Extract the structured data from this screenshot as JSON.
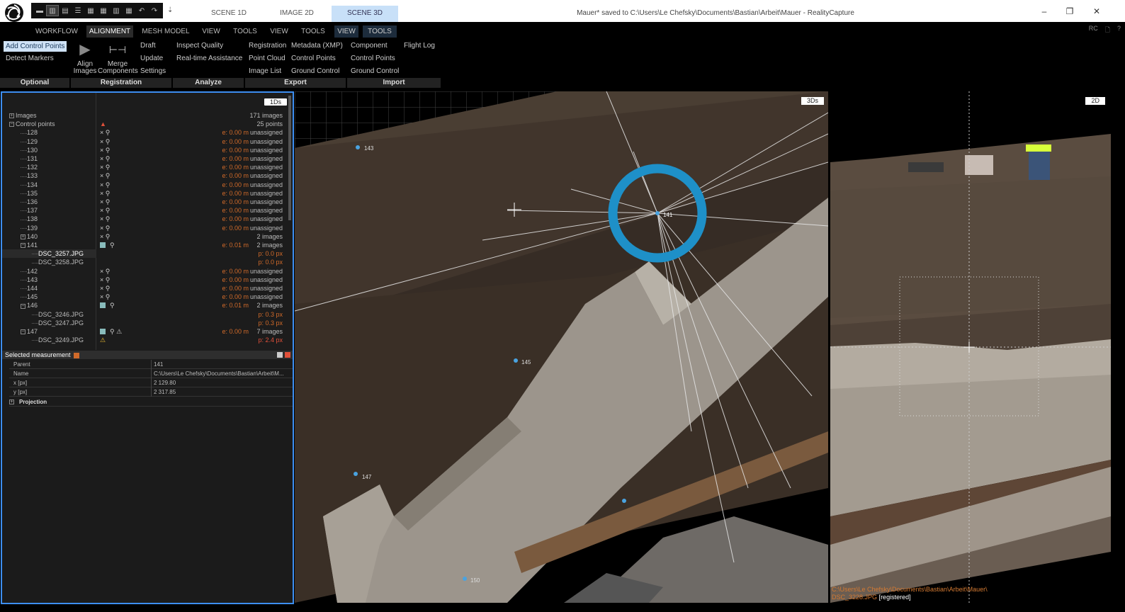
{
  "titlebar": {
    "window_title": "Mauer* saved to C:\\Users\\Le Chefsky\\Documents\\Bastian\\Arbeit\\Mauer - RealityCapture",
    "layout_tabs": [
      "SCENE 1D",
      "IMAGE 2D",
      "SCENE 3D"
    ],
    "active_layout": "SCENE 3D",
    "minimize": "–",
    "restore": "❐",
    "close": "✕",
    "qa_more": "⇣"
  },
  "ribbon_tabs": [
    "WORKFLOW",
    "ALIGNMENT",
    "MESH MODEL",
    "VIEW",
    "TOOLS",
    "VIEW",
    "TOOLS",
    "VIEW",
    "TOOLS"
  ],
  "ribbon_right": [
    "RC",
    "🗋",
    "?"
  ],
  "ribbon": {
    "optional": {
      "label": "Optional",
      "add_control_points": "Add Control Points",
      "detect_markers": "Detect Markers"
    },
    "registration": {
      "label": "Registration",
      "align_images": "Align Images",
      "merge_components": "Merge Components",
      "draft": "Draft",
      "update": "Update",
      "settings": "Settings"
    },
    "analyze": {
      "label": "Analyze",
      "inspect_quality": "Inspect Quality",
      "realtime_assistance": "Real-time Assistance"
    },
    "export": {
      "label": "Export",
      "registration": "Registration",
      "point_cloud": "Point Cloud",
      "image_list": "Image List",
      "metadata": "Metadata (XMP)",
      "control_points": "Control Points",
      "ground_control": "Ground Control"
    },
    "import": {
      "label": "Import",
      "component": "Component",
      "control_points": "Control Points",
      "ground_control": "Ground Control",
      "flight_log": "Flight Log"
    }
  },
  "tree": {
    "badge": "1Ds",
    "rows": [
      {
        "name": "Images",
        "pm": "+",
        "indent": 0,
        "status": "171 images"
      },
      {
        "name": "Control points",
        "pm": "−",
        "indent": 0,
        "warn": "▲",
        "status": "25 points"
      },
      {
        "name": "128",
        "indent": 1,
        "icons": "× ⚲",
        "err": "e: 0.00 m",
        "status": "unassigned"
      },
      {
        "name": "129",
        "indent": 1,
        "icons": "× ⚲",
        "err": "e: 0.00 m",
        "status": "unassigned"
      },
      {
        "name": "130",
        "indent": 1,
        "icons": "× ⚲",
        "err": "e: 0.00 m",
        "status": "unassigned"
      },
      {
        "name": "131",
        "indent": 1,
        "icons": "× ⚲",
        "err": "e: 0.00 m",
        "status": "unassigned"
      },
      {
        "name": "132",
        "indent": 1,
        "icons": "× ⚲",
        "err": "e: 0.00 m",
        "status": "unassigned"
      },
      {
        "name": "133",
        "indent": 1,
        "icons": "× ⚲",
        "err": "e: 0.00 m",
        "status": "unassigned"
      },
      {
        "name": "134",
        "indent": 1,
        "icons": "× ⚲",
        "err": "e: 0.00 m",
        "status": "unassigned"
      },
      {
        "name": "135",
        "indent": 1,
        "icons": "× ⚲",
        "err": "e: 0.00 m",
        "status": "unassigned"
      },
      {
        "name": "136",
        "indent": 1,
        "icons": "× ⚲",
        "err": "e: 0.00 m",
        "status": "unassigned"
      },
      {
        "name": "137",
        "indent": 1,
        "icons": "× ⚲",
        "err": "e: 0.00 m",
        "status": "unassigned"
      },
      {
        "name": "138",
        "indent": 1,
        "icons": "× ⚲",
        "err": "e: 0.00 m",
        "status": "unassigned"
      },
      {
        "name": "139",
        "indent": 1,
        "icons": "× ⚲",
        "err": "e: 0.00 m",
        "status": "unassigned"
      },
      {
        "name": "140",
        "pm": "+",
        "indent": 1,
        "icons": "× ⚲",
        "status": "2 images"
      },
      {
        "name": "141",
        "pm": "−",
        "indent": 1,
        "check": true,
        "icons": "⚲",
        "err": "e: 0.01 m",
        "status": "2 images"
      },
      {
        "name": "DSC_3257.JPG",
        "indent": 2,
        "selected": true,
        "px": "p: 0.0 px"
      },
      {
        "name": "DSC_3258.JPG",
        "indent": 2,
        "px": "p: 0.0 px"
      },
      {
        "name": "142",
        "indent": 1,
        "icons": "× ⚲",
        "err": "e: 0.00 m",
        "status": "unassigned"
      },
      {
        "name": "143",
        "indent": 1,
        "icons": "× ⚲",
        "err": "e: 0.00 m",
        "status": "unassigned"
      },
      {
        "name": "144",
        "indent": 1,
        "icons": "× ⚲",
        "err": "e: 0.00 m",
        "status": "unassigned"
      },
      {
        "name": "145",
        "indent": 1,
        "icons": "× ⚲",
        "err": "e: 0.00 m",
        "status": "unassigned"
      },
      {
        "name": "146",
        "pm": "−",
        "indent": 1,
        "check": true,
        "icons": "⚲",
        "err": "e: 0.01 m",
        "status": "2 images"
      },
      {
        "name": "DSC_3246.JPG",
        "indent": 2,
        "px": "p: 0.3 px"
      },
      {
        "name": "DSC_3247.JPG",
        "indent": 2,
        "px": "p: 0.3 px"
      },
      {
        "name": "147",
        "pm": "−",
        "indent": 1,
        "check": true,
        "icons": "⚲ ⚠",
        "err": "e: 0.00 m",
        "status": "7 images"
      },
      {
        "name": "DSC_3249.JPG",
        "indent": 2,
        "warn": "⚠",
        "px": "p: 2.4 px",
        "red": true
      }
    ]
  },
  "selected_measurement": {
    "title": "Selected measurement",
    "properties": [
      {
        "key": "Parent",
        "value": "141"
      },
      {
        "key": "Name",
        "value": "C:\\Users\\Le Chefsky\\Documents\\Bastian\\Arbeit\\M..."
      },
      {
        "key": "x [px]",
        "value": "2 129.80"
      },
      {
        "key": "y [px]",
        "value": "2 317.85"
      }
    ],
    "projection": "Projection"
  },
  "view3d": {
    "badge": "3Ds",
    "labels": [
      {
        "text": "143"
      },
      {
        "text": "141"
      },
      {
        "text": "145"
      },
      {
        "text": "147"
      },
      {
        "text": "150"
      }
    ]
  },
  "view2d": {
    "badge": "2D",
    "path_line1": "C:\\Users\\Le Chefsky\\Documents\\Bastian\\Arbeit\\Mauer\\",
    "path_file": "DSC_3228.JPG",
    "path_status": "[registered]"
  },
  "colors": {
    "accent": "#3d8ef0",
    "error": "#d06a2a",
    "marker": "#1e90c8"
  }
}
